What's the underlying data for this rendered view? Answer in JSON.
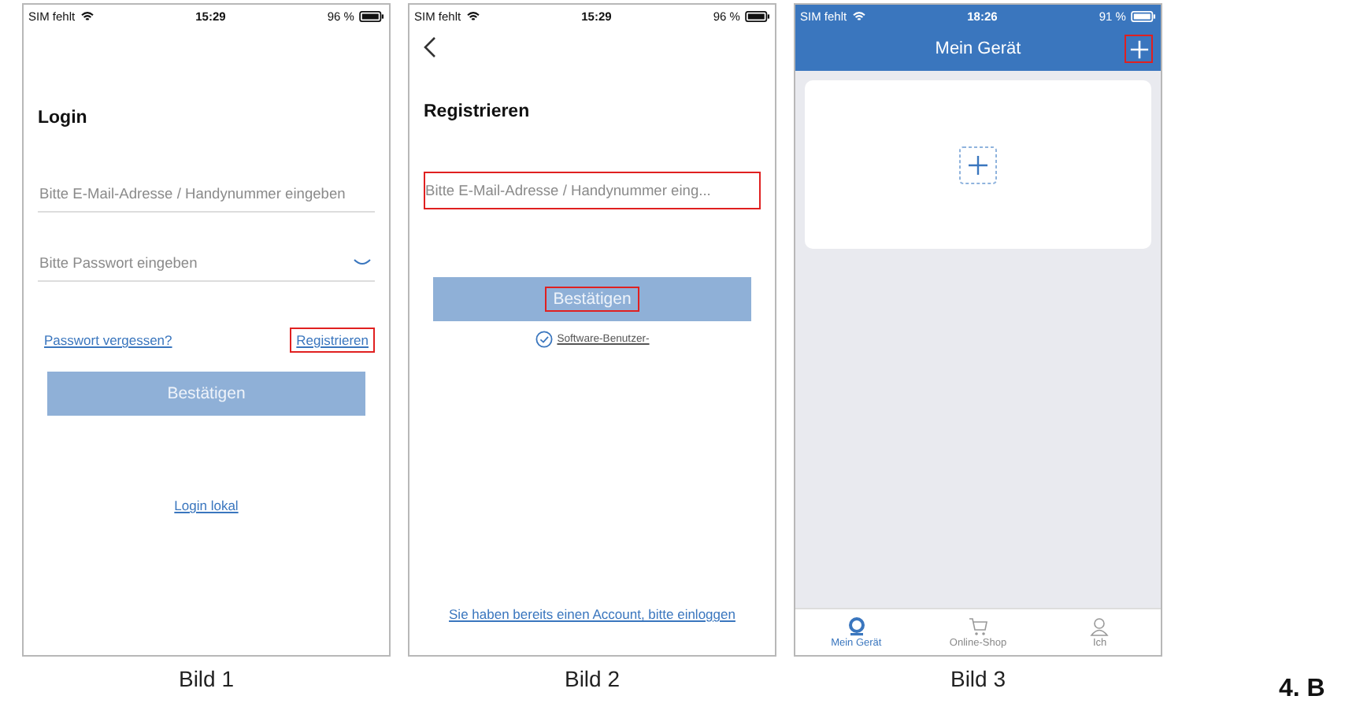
{
  "screens": [
    {
      "kind": "login",
      "caption": "Bild 1",
      "status_bar": {
        "carrier": "SIM fehlt",
        "time": "15:29",
        "battery": "96 %"
      },
      "title": "Login",
      "fields": [
        {
          "placeholder": "Bitte E-Mail-Adresse / Handynummer eingeben",
          "highlighted": false,
          "eye_toggle": false
        },
        {
          "placeholder": "Bitte Passwort eingeben",
          "highlighted": false,
          "eye_toggle": true
        }
      ],
      "links": [
        {
          "label": "Passwort vergessen?",
          "highlighted": false
        },
        {
          "label": "Registrieren",
          "highlighted": true
        }
      ],
      "button": {
        "label": "Bestätigen",
        "highlighted": false
      },
      "footer_link": "Login lokal"
    },
    {
      "kind": "register",
      "caption": "Bild 2",
      "status_bar": {
        "carrier": "SIM fehlt",
        "time": "15:29",
        "battery": "96 %"
      },
      "back": true,
      "title": "Registrieren",
      "fields": [
        {
          "placeholder": "Bitte E-Mail-Adresse / Handynummer eing...",
          "highlighted": true,
          "eye_toggle": false
        }
      ],
      "button": {
        "label": "Bestätigen",
        "highlighted": true
      },
      "agreement": {
        "checked": true,
        "link": "Software-Benutzer-"
      },
      "footer_link": "Sie haben bereits einen Account, bitte einloggen"
    },
    {
      "kind": "devices",
      "caption": "Bild 3",
      "status_bar": {
        "carrier": "SIM fehlt",
        "time": "18:26",
        "battery": "91 %"
      },
      "title": "Mein Gerät",
      "add_highlighted": true,
      "tabs": [
        {
          "label": "Mein Gerät",
          "selected": true
        },
        {
          "label": "Online-Shop",
          "selected": false
        },
        {
          "label": "Ich",
          "selected": false
        }
      ]
    }
  ],
  "page_fragment": "4. B"
}
